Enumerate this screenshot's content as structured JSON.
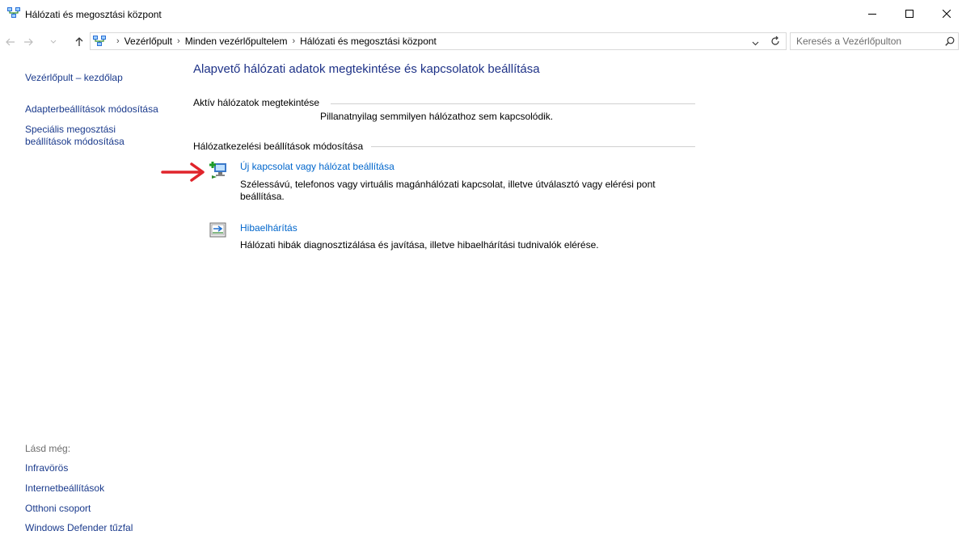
{
  "window": {
    "title": "Hálózati és megosztási központ",
    "controls": [
      "minimize",
      "maximize",
      "close"
    ]
  },
  "nav": {
    "breadcrumbs": [
      "Vezérlőpult",
      "Minden vezérlőpultelem",
      "Hálózati és megosztási központ"
    ],
    "search_placeholder": "Keresés a Vezérlőpulton"
  },
  "sidebar": {
    "home": "Vezérlőpult – kezdőlap",
    "adapter": "Adapterbeállítások módosítása",
    "sharing_line1": "Speciális megosztási",
    "sharing_line2": "beállítások módosítása"
  },
  "see_also": {
    "heading": "Lásd még:",
    "items": [
      "Infravörös",
      "Internetbeállítások",
      "Otthoni csoport",
      "Windows Defender tűzfal"
    ]
  },
  "main": {
    "title": "Alapvető hálózati adatok megtekintése és kapcsolatok beállítása",
    "active_networks_heading": "Aktív hálózatok megtekintése",
    "no_connection_msg": "Pillanatnyilag semmilyen hálózathoz sem kapcsolódik.",
    "change_settings_heading": "Hálózatkezelési beállítások módosítása",
    "tasks": [
      {
        "title": "Új kapcsolat vagy hálózat beállítása",
        "description": "Szélessávú, telefonos vagy virtuális magánhálózati kapcsolat, illetve útválasztó vagy elérési pont beállítása.",
        "icon": "new-connection-icon"
      },
      {
        "title": "Hibaelhárítás",
        "description": "Hálózati hibák diagnosztizálása és javítása, illetve hibaelhárítási tudnivalók elérése.",
        "icon": "troubleshoot-icon"
      }
    ]
  },
  "colors": {
    "link": "#0066cc",
    "sidebar_link": "#1a3a8c",
    "title": "#1e3287",
    "annotation_arrow": "#e0242b"
  }
}
